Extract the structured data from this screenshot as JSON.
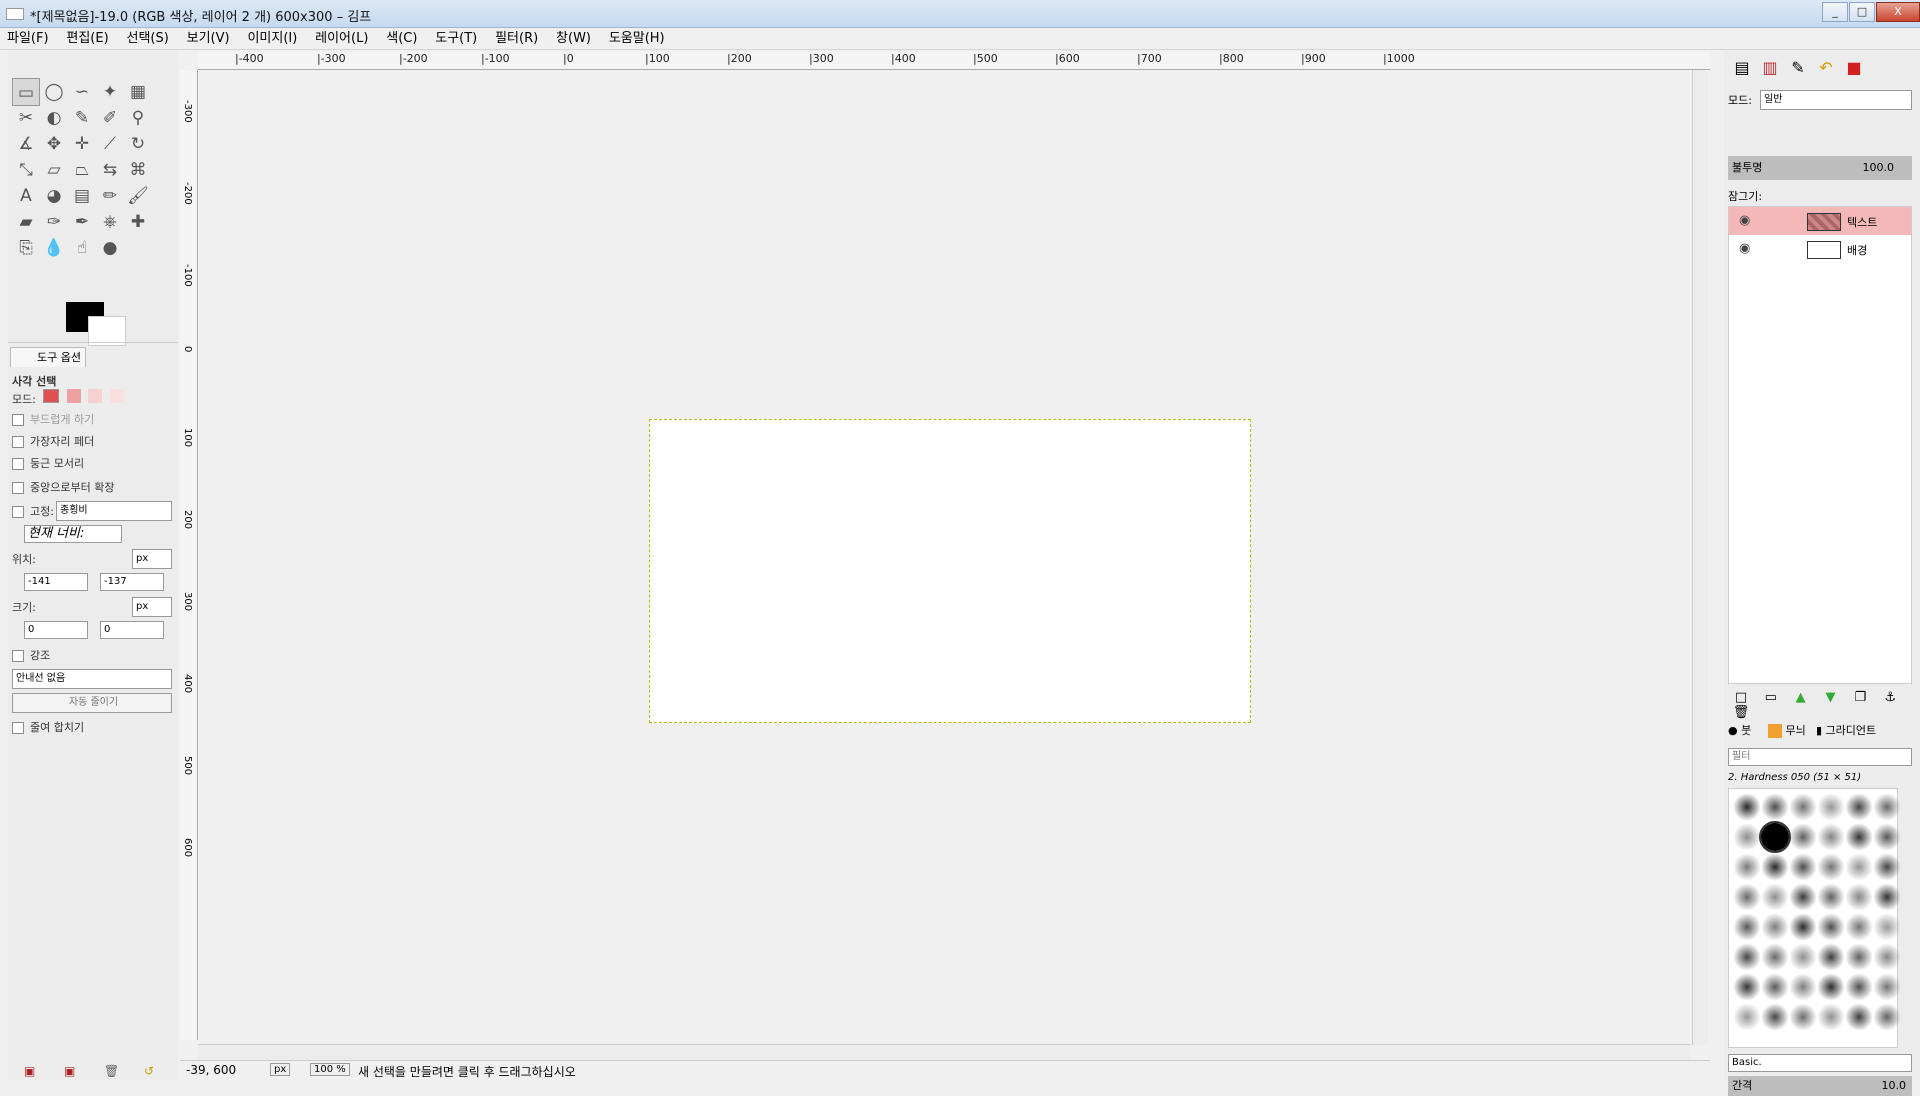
{
  "window": {
    "title": "*[제목없음]-19.0 (RGB 색상, 레이어 2 개) 600x300 – 김프",
    "controls": [
      "_",
      "□",
      "X"
    ]
  },
  "menubar": {
    "items": [
      "파일(F)",
      "편집(E)",
      "선택(S)",
      "보기(V)",
      "이미지(I)",
      "레이어(L)",
      "색(C)",
      "도구(T)",
      "필터(R)",
      "창(W)",
      "도움말(H)"
    ]
  },
  "toolbox": {
    "tools": [
      {
        "name": "rect-select",
        "glyph": "▭"
      },
      {
        "name": "ellipse-select",
        "glyph": "◯"
      },
      {
        "name": "free-select",
        "glyph": "∽"
      },
      {
        "name": "fuzzy-select",
        "glyph": "✦"
      },
      {
        "name": "color-select",
        "glyph": "▦"
      },
      {
        "name": "scissors",
        "glyph": "✂"
      },
      {
        "name": "foreground-select",
        "glyph": "◐"
      },
      {
        "name": "paths",
        "glyph": "✎"
      },
      {
        "name": "color-picker",
        "glyph": "✐"
      },
      {
        "name": "zoom",
        "glyph": "⚲"
      },
      {
        "name": "measure",
        "glyph": "∡"
      },
      {
        "name": "move",
        "glyph": "✥"
      },
      {
        "name": "align",
        "glyph": "✛"
      },
      {
        "name": "crop",
        "glyph": "⟋"
      },
      {
        "name": "rotate",
        "glyph": "↻"
      },
      {
        "name": "scale",
        "glyph": "⤡"
      },
      {
        "name": "shear",
        "glyph": "▱"
      },
      {
        "name": "perspective",
        "glyph": "⏢"
      },
      {
        "name": "flip",
        "glyph": "⇆"
      },
      {
        "name": "cage",
        "glyph": "⌘"
      },
      {
        "name": "text",
        "glyph": "A"
      },
      {
        "name": "bucket-fill",
        "glyph": "◕"
      },
      {
        "name": "blend",
        "glyph": "▤"
      },
      {
        "name": "pencil",
        "glyph": "✏"
      },
      {
        "name": "paintbrush",
        "glyph": "🖌"
      },
      {
        "name": "eraser",
        "glyph": "▰"
      },
      {
        "name": "airbrush",
        "glyph": "✑"
      },
      {
        "name": "ink",
        "glyph": "✒"
      },
      {
        "name": "clone",
        "glyph": "⎈"
      },
      {
        "name": "heal",
        "glyph": "✚"
      },
      {
        "name": "perspective-clone",
        "glyph": "⎘"
      },
      {
        "name": "blur",
        "glyph": "💧"
      },
      {
        "name": "smudge",
        "glyph": "☝"
      },
      {
        "name": "dodge-burn",
        "glyph": "●"
      }
    ],
    "options_tab": "도구 옵션",
    "tool_name": "사각 선택",
    "mode_label": "모드:",
    "antialias": "부드럽게 하기",
    "feather": "가장자리 페더",
    "rounded": "둥근 모서리",
    "expand_center": "중앙으로부터 확장",
    "fixed_label": "고정:",
    "fixed_value": "종횡비",
    "current_label": "현재 너비:",
    "position_label": "위치:",
    "unit": "px",
    "pos_x": "-141",
    "pos_y": "-137",
    "size_label": "크기:",
    "size_w": "0",
    "size_h": "0",
    "highlight": "강조",
    "guides": "안내선 없음",
    "auto_shrink": "자동 줄이기",
    "shrink_merged": "줄여 합치기"
  },
  "canvas": {
    "hruler_labels": [
      "-400",
      "-300",
      "-200",
      "-100",
      "0",
      "100",
      "200",
      "300",
      "400",
      "500",
      "600",
      "700",
      "800",
      "900",
      "1000"
    ],
    "vruler_labels": [
      "-300",
      "-200",
      "-100",
      "0",
      "100",
      "200",
      "300",
      "400",
      "500",
      "600"
    ]
  },
  "status": {
    "coords": "-39, 600",
    "unit": "px",
    "zoom": "100 %",
    "message": "새 선택을 만들려면 클릭 후 드래그하십시오"
  },
  "layers": {
    "mode_label": "모드:",
    "mode_value": "일반",
    "opacity_label": "불투명",
    "opacity_value": "100.0",
    "lock_label": "잠그기:",
    "items": [
      {
        "name": "텍스트",
        "selected": true
      },
      {
        "name": "배경",
        "selected": false
      }
    ]
  },
  "brushes": {
    "tab_brush": "붓",
    "tab_pattern": "무늬",
    "tab_gradient": "그라디언트",
    "filter_placeholder": "필터",
    "current": "2. Hardness 050 (51 × 51)",
    "preset": "Basic.",
    "spacing_label": "간격",
    "spacing_value": "10.0"
  },
  "colors": {
    "accent_selected_layer": "#f4b8b8",
    "selection_border": "#b9b900"
  }
}
